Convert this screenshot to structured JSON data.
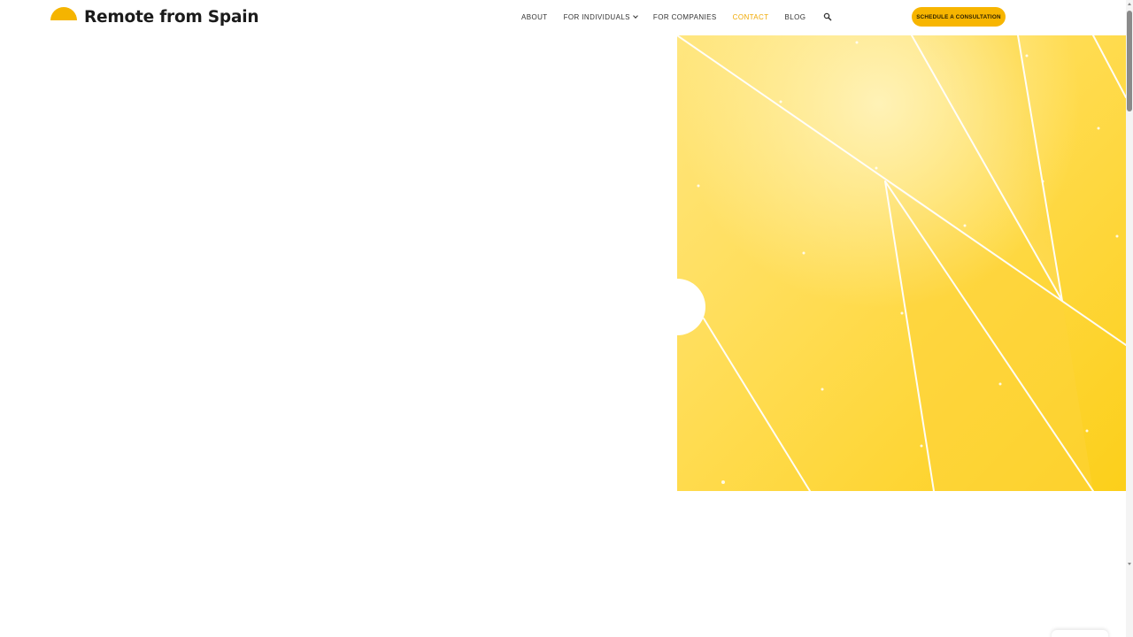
{
  "header": {
    "logo_text": "Remote from Spain",
    "nav": [
      {
        "label": "ABOUT",
        "active": false
      },
      {
        "label": "FOR INDIVIDUALS",
        "active": false,
        "has_dropdown": true
      },
      {
        "label": "FOR COMPANIES",
        "active": false
      },
      {
        "label": "CONTACT",
        "active": true
      },
      {
        "label": "BLOG",
        "active": false
      }
    ],
    "search_icon": "search-icon",
    "cta_label": "SCHEDULE A CONSULTATION"
  },
  "colors": {
    "brand_yellow": "#f7b500",
    "active_nav": "#f0a800",
    "hero_yellow_light": "#ffe680",
    "hero_yellow_dark": "#fccf1a"
  },
  "hero": {
    "image": "abstract yellow fan-shaped panels with glowing white lines"
  }
}
